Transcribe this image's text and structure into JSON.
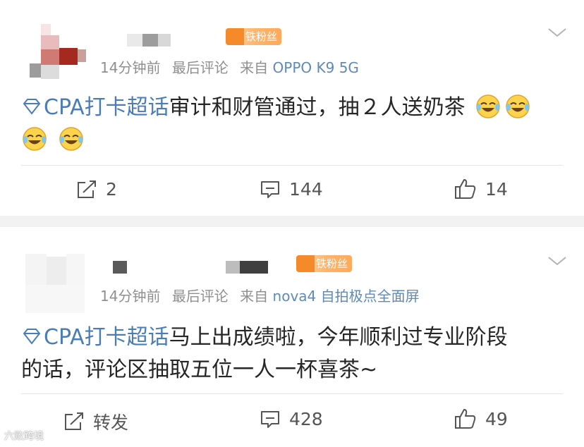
{
  "posts": [
    {
      "fan_badge": "铁粉丝",
      "meta": {
        "time": "14分钟前",
        "activity": "最后评论",
        "source_prefix": "来自",
        "device": "OPPO K9 5G"
      },
      "content": {
        "topic": "CPA打卡超话",
        "text": "审计和财管通过，抽２人送奶茶",
        "line2_emoji_count": 2
      },
      "actions": {
        "repost": "2",
        "comments": "144",
        "likes": "14"
      }
    },
    {
      "fan_badge": "铁粉丝",
      "meta": {
        "time": "14分钟前",
        "activity": "最后评论",
        "source_prefix": "来自",
        "device": "nova4 自拍极点全面屏"
      },
      "content": {
        "topic": "CPA打卡超话",
        "line1": "马上出成绩啦，今年顺利过专业阶段",
        "line2": "的话，评论区抽取五位一人一杯喜茶~"
      },
      "actions": {
        "repost": "转发",
        "comments": "428",
        "likes": "49"
      }
    }
  ],
  "watermark": "六败跨境",
  "colors": {
    "topic": "#4a7db8",
    "meta": "#8f8f8f",
    "badge": "#ffa95a",
    "background": "#f2f2f2"
  }
}
